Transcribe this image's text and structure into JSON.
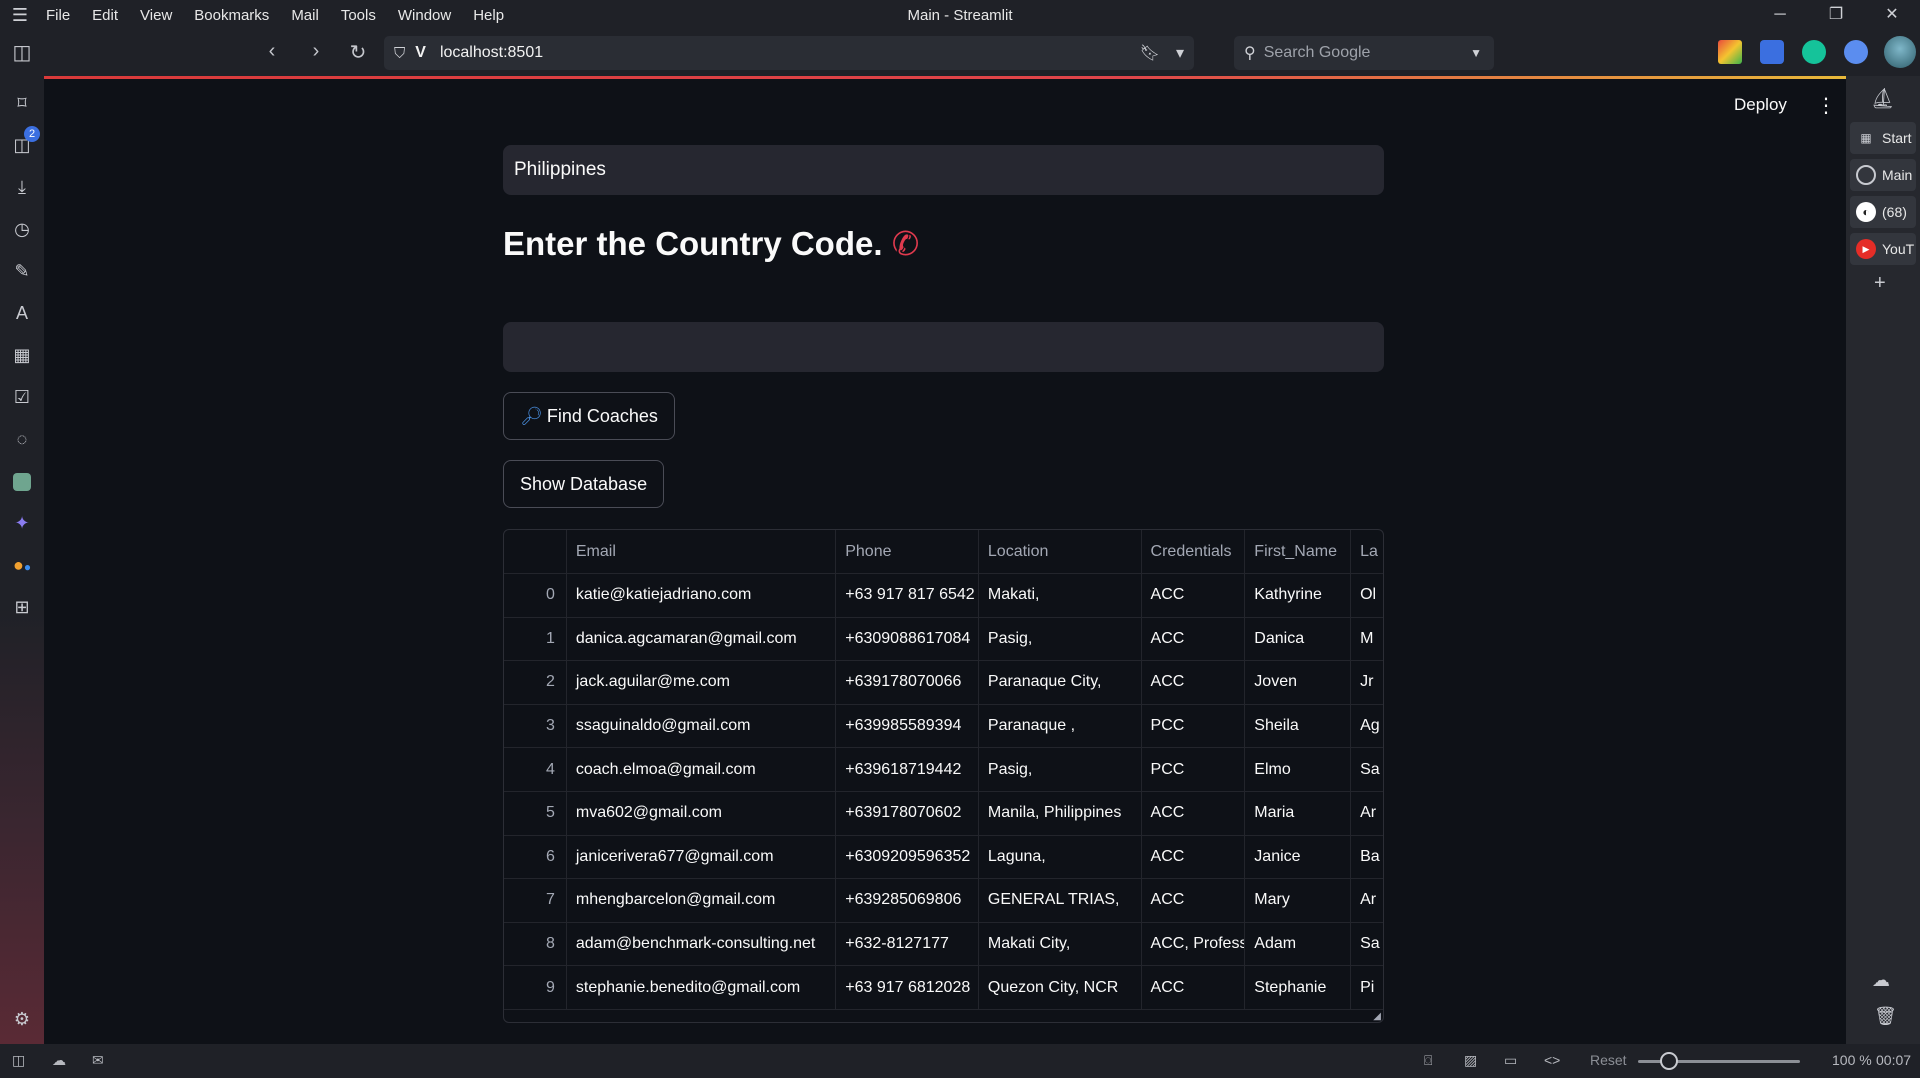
{
  "window": {
    "title": "Main - Streamlit"
  },
  "menu": [
    "File",
    "Edit",
    "View",
    "Bookmarks",
    "Mail",
    "Tools",
    "Window",
    "Help"
  ],
  "toolbar": {
    "url": "localhost:8501",
    "search_placeholder": "Search Google"
  },
  "left_panel": {
    "tabs_badge": "2"
  },
  "right_panel": {
    "items": [
      "Start",
      "Main",
      "(68)",
      "YouT"
    ]
  },
  "streamlit": {
    "deploy_label": "Deploy"
  },
  "app": {
    "country_value": "Philippines",
    "heading": "Enter the Country Code.",
    "code_value": "",
    "find_button": "Find Coaches",
    "show_db_button": "Show Database"
  },
  "table": {
    "columns": [
      "Email",
      "Phone",
      "Location",
      "Credentials",
      "First_Name",
      "La"
    ],
    "rows": [
      {
        "idx": "0",
        "email": "katie@katiejadriano.com",
        "phone": "+63 917 817 6542",
        "location": "Makati,",
        "cred": "ACC",
        "first": "Kathyrine",
        "last": "Ol"
      },
      {
        "idx": "1",
        "email": "danica.agcamaran@gmail.com",
        "phone": "+6309088617084",
        "location": "Pasig,",
        "cred": "ACC",
        "first": "Danica",
        "last": "M"
      },
      {
        "idx": "2",
        "email": "jack.aguilar@me.com",
        "phone": "+639178070066",
        "location": "Paranaque City,",
        "cred": "ACC",
        "first": "Joven",
        "last": "Jr"
      },
      {
        "idx": "3",
        "email": "ssaguinaldo@gmail.com",
        "phone": "+639985589394",
        "location": "Paranaque ,",
        "cred": "PCC",
        "first": "Sheila",
        "last": "Ag"
      },
      {
        "idx": "4",
        "email": "coach.elmoa@gmail.com",
        "phone": "+639618719442",
        "location": "Pasig,",
        "cred": "PCC",
        "first": "Elmo",
        "last": "Sa"
      },
      {
        "idx": "5",
        "email": "mva602@gmail.com",
        "phone": "+639178070602",
        "location": "Manila, Philippines",
        "cred": "ACC",
        "first": "Maria",
        "last": "Ar"
      },
      {
        "idx": "6",
        "email": "janicerivera677@gmail.com",
        "phone": "+6309209596352",
        "location": "Laguna,",
        "cred": "ACC",
        "first": "Janice",
        "last": "Ba"
      },
      {
        "idx": "7",
        "email": "mhengbarcelon@gmail.com",
        "phone": "+639285069806",
        "location": "GENERAL TRIAS,",
        "cred": "ACC",
        "first": "Mary",
        "last": "Ar"
      },
      {
        "idx": "8",
        "email": "adam@benchmark-consulting.net",
        "phone": "+632-8127177",
        "location": "Makati City,",
        "cred": "ACC, Profess",
        "first": "Adam",
        "last": "Sa"
      },
      {
        "idx": "9",
        "email": "stephanie.benedito@gmail.com",
        "phone": "+63 917 6812028",
        "location": "Quezon City, NCR",
        "cred": "ACC",
        "first": "Stephanie",
        "last": "Pi"
      }
    ]
  },
  "statusbar": {
    "reset_label": "Reset",
    "zoom": "100 %",
    "clock": "00:07"
  }
}
